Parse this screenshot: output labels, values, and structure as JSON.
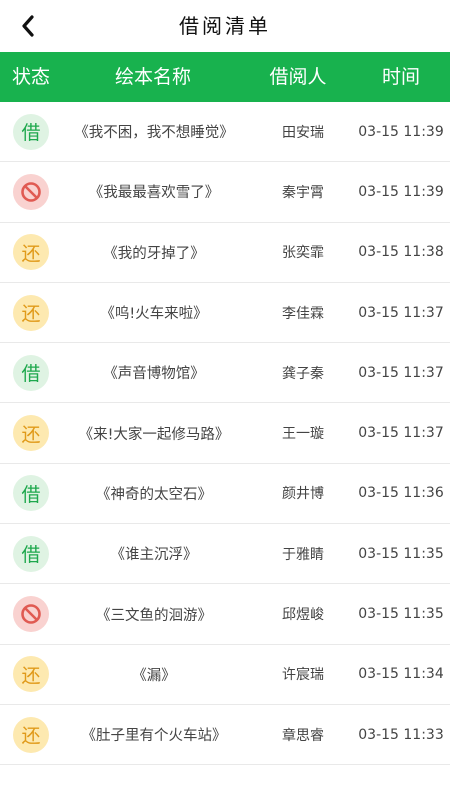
{
  "header": {
    "title": "借阅清单",
    "back_icon": "chevron-left-icon"
  },
  "table": {
    "columns": {
      "status": "状态",
      "name": "绘本名称",
      "person": "借阅人",
      "time": "时间"
    },
    "rows": [
      {
        "status": "borrow",
        "status_text": "借",
        "name": "《我不困，我不想睡觉》",
        "person": "田安瑞",
        "time": "03-15 11:39"
      },
      {
        "status": "cancel",
        "status_text": "",
        "name": "《我最最喜欢雪了》",
        "person": "秦宇霄",
        "time": "03-15 11:39"
      },
      {
        "status": "return",
        "status_text": "还",
        "name": "《我的牙掉了》",
        "person": "张奕霏",
        "time": "03-15 11:38"
      },
      {
        "status": "return",
        "status_text": "还",
        "name": "《呜!火车来啦》",
        "person": "李佳霖",
        "time": "03-15 11:37"
      },
      {
        "status": "borrow",
        "status_text": "借",
        "name": "《声音博物馆》",
        "person": "龚子秦",
        "time": "03-15 11:37"
      },
      {
        "status": "return",
        "status_text": "还",
        "name": "《来!大家一起修马路》",
        "person": "王一璇",
        "time": "03-15 11:37"
      },
      {
        "status": "borrow",
        "status_text": "借",
        "name": "《神奇的太空石》",
        "person": "颜井博",
        "time": "03-15 11:36"
      },
      {
        "status": "borrow",
        "status_text": "借",
        "name": "《谁主沉浮》",
        "person": "于雅睛",
        "time": "03-15 11:35"
      },
      {
        "status": "cancel",
        "status_text": "",
        "name": "《三文鱼的洄游》",
        "person": "邱煜峻",
        "time": "03-15 11:35"
      },
      {
        "status": "return",
        "status_text": "还",
        "name": "《漏》",
        "person": "许宸瑞",
        "time": "03-15 11:34"
      },
      {
        "status": "return",
        "status_text": "还",
        "name": "《肚子里有个火车站》",
        "person": "章思睿",
        "time": "03-15 11:33"
      }
    ]
  },
  "colors": {
    "accent": "#18b24e",
    "borrow": "#1ea84d",
    "return": "#e09a1a",
    "cancel": "#e05a52"
  }
}
